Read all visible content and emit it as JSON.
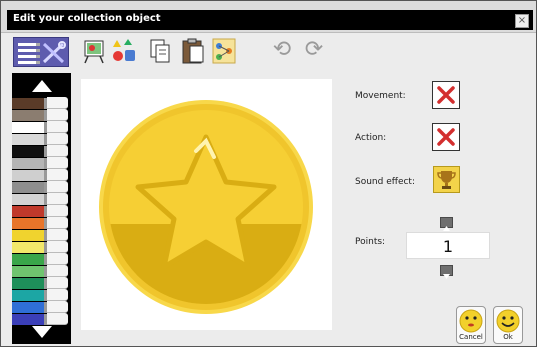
{
  "dialog": {
    "title": "Edit your collection object",
    "close_label": "×"
  },
  "toolbar": {
    "undo_glyph": "⟲",
    "redo_glyph": "⟳"
  },
  "palette": {
    "up_icon": "triangle-up-icon",
    "down_icon": "triangle-down-icon",
    "markers": [
      "#5a3b28",
      "#8b7d70",
      "#ffffff",
      "#d9d9d9",
      "#101010",
      "#b5b5b5",
      "#cfcfcf",
      "#8e8e8e",
      "#d3d3d3",
      "#c0392b",
      "#e8752a",
      "#f0d32e",
      "#f3e86a",
      "#3aa64a",
      "#6fc46f",
      "#1e8f5a",
      "#1ca6a4",
      "#2f6fd6",
      "#3b3fb8"
    ]
  },
  "properties": {
    "movement_label": "Movement:",
    "action_label": "Action:",
    "sound_label": "Sound effect:",
    "points_label": "Points:",
    "points_value": "1"
  },
  "buttons": {
    "cancel_label": "Cancel",
    "ok_label": "Ok"
  },
  "colors": {
    "accent": "#5e5cae",
    "x_mark": "#d32f2f",
    "coin_gold": "#f4c92f",
    "coin_dark": "#d7aa14"
  }
}
